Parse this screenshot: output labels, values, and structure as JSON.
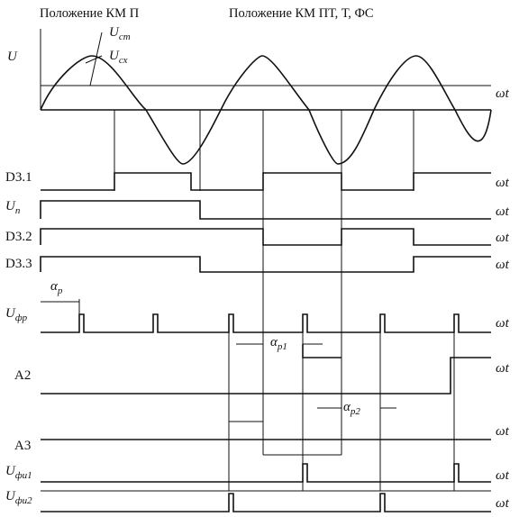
{
  "headers": {
    "left": "Положение КМ П",
    "right": "Положение КМ ПТ, Т, ФС"
  },
  "axis_symbol": "ωt",
  "labels": {
    "u_main": "U",
    "u_st_main": "U",
    "u_st_sub": "ст",
    "u_sx_main": "U",
    "u_sx_sub": "сх",
    "d31": "D3.1",
    "up_main": "U",
    "up_sub": "п",
    "d32": "D3.2",
    "d33": "D3.3",
    "ufr_main": "U",
    "ufr_sub": "фр",
    "alpha_p_main": "α",
    "alpha_p_sub": "р",
    "alpha_p1_main": "α",
    "alpha_p1_sub": "р1",
    "alpha_p2_main": "α",
    "alpha_p2_sub": "р2",
    "a2": "A2",
    "a3": "A3",
    "ufi1_main": "U",
    "ufi1_sub": "фи1",
    "ufi2_main": "U",
    "ufi2_sub": "фи2"
  }
}
